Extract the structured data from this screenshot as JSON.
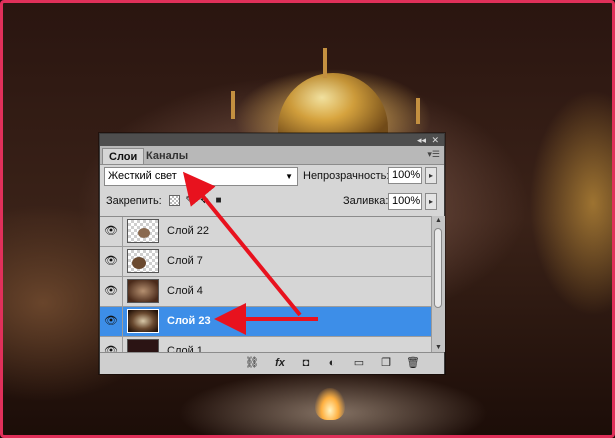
{
  "panel": {
    "tabs": [
      {
        "label": "Слои",
        "active": true
      },
      {
        "label": "Каналы",
        "active": false
      }
    ],
    "titlebar_controls": {
      "collapse": "◂◂",
      "close": "✕"
    },
    "menu_icon": "panel-menu-icon",
    "blend_mode": {
      "value": "Жесткий свет"
    },
    "opacity": {
      "label": "Непрозрачность:",
      "value": "100%"
    },
    "lock": {
      "label": "Закрепить:"
    },
    "fill": {
      "label": "Заливка:",
      "value": "100%"
    },
    "layers": [
      {
        "name": "Слой 22",
        "visible": true,
        "selected": false,
        "thumb": "transparent-figure"
      },
      {
        "name": "Слой 7",
        "visible": true,
        "selected": false,
        "thumb": "transparent-figure"
      },
      {
        "name": "Слой 4",
        "visible": true,
        "selected": false,
        "thumb": "image"
      },
      {
        "name": "Слой 23",
        "visible": true,
        "selected": true,
        "thumb": "image-glow"
      },
      {
        "name": "Слой 1",
        "visible": true,
        "selected": false,
        "thumb": "dark-fill"
      }
    ],
    "bottom_icons": [
      "link-layers-icon",
      "fx-icon",
      "add-mask-icon",
      "adjustment-layer-icon",
      "new-group-icon",
      "new-layer-icon",
      "delete-layer-icon"
    ]
  },
  "colors": {
    "selection": "#3d8ee8",
    "annotation_arrow": "#e8121e",
    "frame_border": "#e0305a"
  }
}
